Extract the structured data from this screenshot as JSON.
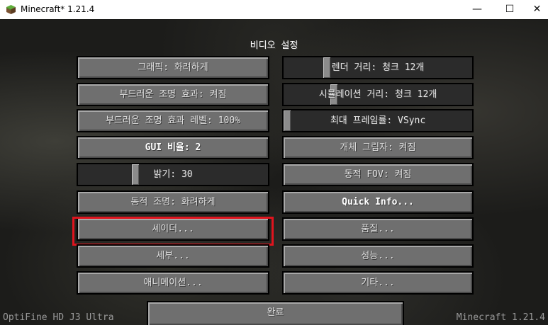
{
  "window": {
    "title": "Minecraft* 1.21.4",
    "controls": {
      "minimize": "—",
      "maximize": "☐",
      "close": "✕"
    }
  },
  "screen": {
    "title": "비디오 설정"
  },
  "left_column": [
    {
      "label": "그래픽: 화려하게",
      "type": "button"
    },
    {
      "label": "부드러운 조명 효과: 켜짐",
      "type": "button"
    },
    {
      "label": "부드러운 조명 효과 레벨: 100%",
      "type": "slider",
      "value": 1.0
    },
    {
      "label": "GUI 비율: 2",
      "type": "button"
    },
    {
      "label": "밝기: 30",
      "type": "slider",
      "value": 0.3
    },
    {
      "label": "동적 조명: 화려하게",
      "type": "button"
    },
    {
      "label": "셰이더...",
      "type": "button"
    },
    {
      "label": "세부...",
      "type": "button"
    },
    {
      "label": "애니메이션...",
      "type": "button"
    }
  ],
  "right_column": [
    {
      "label": "렌더 거리: 청크 12개",
      "type": "slider",
      "value": 0.22
    },
    {
      "label": "시뮬레이션 거리: 청크 12개",
      "type": "slider",
      "value": 0.25
    },
    {
      "label": "최대 프레임률: VSync",
      "type": "slider",
      "value": 0.0
    },
    {
      "label": "개체 그림자: 켜짐",
      "type": "button"
    },
    {
      "label": "동적 FOV: 켜짐",
      "type": "button"
    },
    {
      "label": "Quick Info...",
      "type": "button"
    },
    {
      "label": "품질...",
      "type": "button"
    },
    {
      "label": "성능...",
      "type": "button"
    },
    {
      "label": "기타...",
      "type": "button"
    }
  ],
  "done_button": "완료",
  "footer": {
    "left": "OptiFine HD J3 Ultra",
    "right": "Minecraft 1.21.4"
  },
  "highlight_color": "#e0141e"
}
